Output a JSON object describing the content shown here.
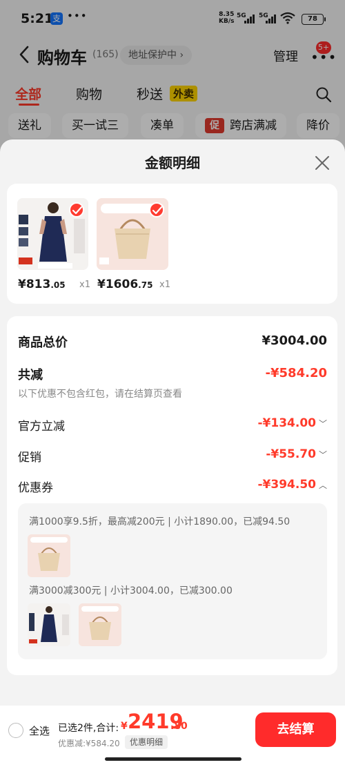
{
  "status": {
    "time": "5:21",
    "app_glyph": "支",
    "dots": "•••",
    "net_speed": "8.35",
    "net_unit": "KB/s",
    "sig1": "5G",
    "sig2": "5G",
    "battery": "78"
  },
  "header": {
    "title": "购物车",
    "count": "(165)",
    "address": "地址保护中 ›",
    "manage": "管理",
    "more_badge": "5+"
  },
  "tabs": [
    {
      "label": "全部"
    },
    {
      "label": "购物"
    },
    {
      "label": "秒送"
    }
  ],
  "tab_tag": "外卖",
  "chips": [
    {
      "label": "送礼"
    },
    {
      "label": "买一试三"
    },
    {
      "label": "凑单"
    },
    {
      "label": "跨店满减",
      "promo": "促"
    },
    {
      "label": "降价"
    }
  ],
  "sheet": {
    "title": "金额明细",
    "products": [
      {
        "price_int": "¥813",
        "price_dec": ".05",
        "qty": "x1"
      },
      {
        "price_int": "¥1606",
        "price_dec": ".75",
        "qty": "x1"
      }
    ],
    "summary": {
      "total_label": "商品总价",
      "total_value": "¥3004.00",
      "reduce_label": "共减",
      "reduce_value": "-¥584.20",
      "note": "以下优惠不包含红包，请在结算页查看",
      "official_label": "官方立减",
      "official_value": "-¥134.00",
      "promo_label": "促销",
      "promo_value": "-¥55.70",
      "coupon_label": "优惠券",
      "coupon_value": "-¥394.50"
    },
    "coupon_rules": [
      "满1000享9.5折，最高减200元 | 小计1890.00，已减94.50",
      "满3000减300元 | 小计3004.00，已减300.00"
    ]
  },
  "bottom": {
    "select_all": "全选",
    "selected_text": "已选2件,合计:",
    "total_symbol": "¥",
    "total_int": "2419",
    "total_dec": ".80",
    "discount_text": "优惠减:¥584.20",
    "discount_detail": "优惠明细",
    "checkout": "去结算"
  },
  "colors": {
    "accent": "#ff3a2a",
    "checkout_bg": "#ff2b2b",
    "tag_yellow": "#ffd400"
  },
  "icons": [
    "back-arrow-icon",
    "more-dots-icon",
    "search-icon",
    "close-icon",
    "check-icon",
    "caret-down-icon",
    "caret-up-icon"
  ]
}
